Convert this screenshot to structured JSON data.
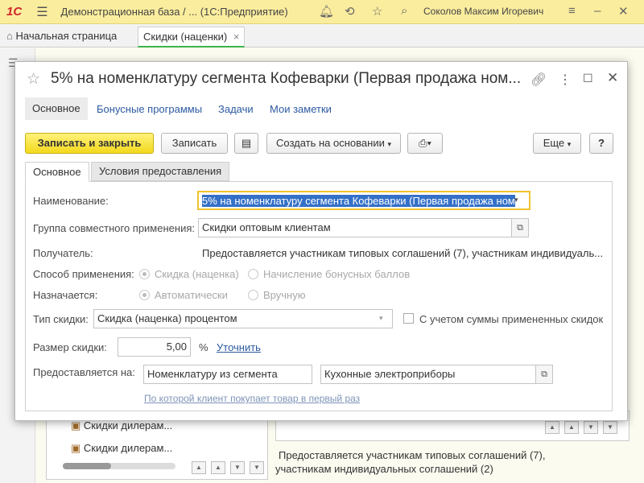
{
  "topbar": {
    "logo": "1С",
    "title": "Демонстрационная база / ... (1С:Предприятие)",
    "user": "Соколов Максим Игоревич"
  },
  "tabs": {
    "home": "Начальная страница",
    "current": "Скидки (наценки)"
  },
  "background": {
    "tree_rows": [
      "Скидки дилерам...",
      "Скидки дилерам..."
    ],
    "bottom_text_1": "Предоставляется участникам типовых соглашений (7),",
    "bottom_text_2": "участникам индивидуальных соглашений (2)"
  },
  "dialog": {
    "title": "5% на номенклатуру сегмента Кофеварки (Первая продажа ном...",
    "nav": {
      "main": "Основное",
      "bonus": "Бонусные программы",
      "tasks": "Задачи",
      "notes": "Мои заметки"
    },
    "toolbar": {
      "save_close": "Записать и закрыть",
      "save": "Записать",
      "create_based": "Создать на основании",
      "more": "Еще",
      "help": "?"
    },
    "inner_tabs": {
      "main": "Основное",
      "conditions": "Условия предоставления"
    },
    "form": {
      "name_label": "Наименование:",
      "name_value": "5% на номенклатуру сегмента Кофеварки (Первая продажа ном",
      "group_label": "Группа совместного применения:",
      "group_value": "Скидки оптовым клиентам",
      "recipient_label": "Получатель:",
      "recipient_value": "Предоставляется участникам типовых соглашений (7), участникам индивидуаль...",
      "method_label": "Способ применения:",
      "method_option_1": "Скидка (наценка)",
      "method_option_2": "Начисление бонусных баллов",
      "assigned_label": "Назначается:",
      "assigned_option_1": "Автоматически",
      "assigned_option_2": "Вручную",
      "discount_type_label": "Тип скидки:",
      "discount_type_value": "Скидка (наценка) процентом",
      "consider_sum_label": "С учетом суммы примененных скидок",
      "size_label": "Размер скидки:",
      "size_value": "5,00",
      "size_unit": "%",
      "refine_link": "Уточнить",
      "provided_label": "Предоставляется на:",
      "provided_value_1": "Номенклатуру из сегмента",
      "provided_value_2": "Кухонные электроприборы",
      "first_purchase_link": "По которой клиент покупает товар в первый раз"
    }
  }
}
